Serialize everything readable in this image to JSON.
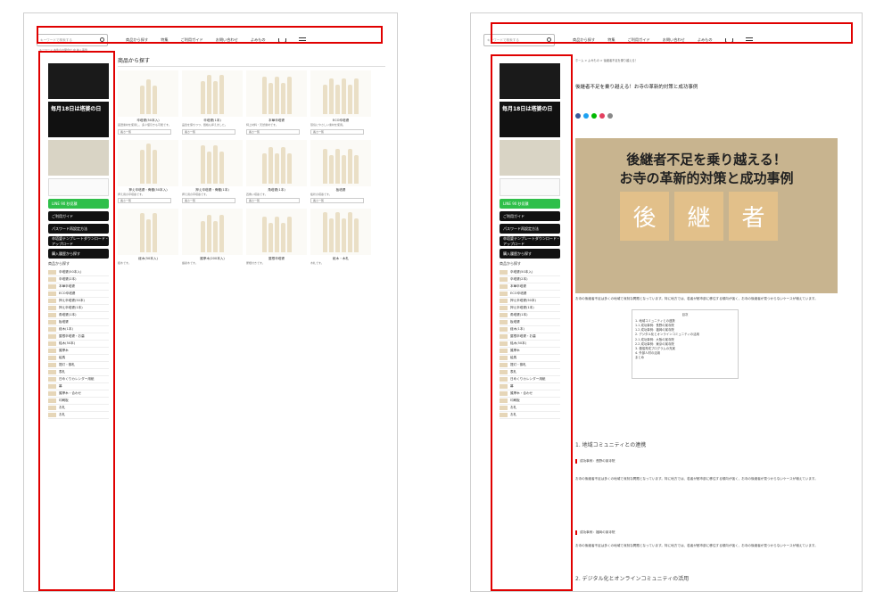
{
  "left": {
    "search_placeholder": "キーワードで検索する",
    "search_hint": "キーワード 本件のお問合せ 中 納入事例",
    "nav": [
      "商品から探す",
      "特集",
      "ご利用ガイド",
      "お問い合わせ",
      "よみもの"
    ],
    "sidebar_buttons": [
      "LINE 90 秒見積",
      "ご利用ガイド",
      "パスワード再設定方法",
      "卒塔婆テンプレートダウンロード・アップロード",
      "購入履歴から探す"
    ],
    "sidebar_section": "商品から探す",
    "sidebar_cats": [
      "卒塔婆(50本入)",
      "卒塔婆(2本)",
      "本華卒塔婆",
      "ECO卒塔婆",
      "押え卒塔婆(50本)",
      "押え卒塔婆(1本)",
      "角塔婆(1本)",
      "板塔婆",
      "経木(1本)",
      "屋根卒塔婆・お墓",
      "銘木(50本)",
      "護摩木",
      "絵馬",
      "提灯・御札",
      "表札",
      "日めくりカレンダー用紙",
      "幕",
      "護摩木・合わせ",
      "印刷板",
      "お札",
      "お札"
    ],
    "grid_title": "商品から探す",
    "products": [
      {
        "name": "卒塔婆(50本入)",
        "desc": "厳選素材を使用し、多少値引きも可能です。"
      },
      {
        "name": "卒塔婆(1本)",
        "desc": "品質を保ちつつ、価格も抑えました。"
      },
      {
        "name": "本華卒塔婆",
        "desc": "特上材料・天然素材です。"
      },
      {
        "name": "ECO卒塔婆",
        "desc": "環境にやさしい素材を使用。"
      },
      {
        "name": "押え卒塔婆・骨棚(50本入)",
        "desc": "押え用の卒塔婆です。"
      },
      {
        "name": "押え卒塔婆・骨棚(1本)",
        "desc": "押え用の卒塔婆です。"
      },
      {
        "name": "角塔婆(1本)",
        "desc": "四角い塔婆です。"
      },
      {
        "name": "板塔婆",
        "desc": "板状の塔婆です。"
      },
      {
        "name": "経木(50本入)",
        "desc": "経木です。"
      },
      {
        "name": "護摩木(200本入)",
        "desc": "護摩木です。"
      },
      {
        "name": "屋根卒塔婆",
        "desc": "屋根付きです。"
      },
      {
        "name": "紙木・木札",
        "desc": "木札です。"
      }
    ],
    "select_label": "長さ一覧",
    "feature_title": "特集"
  },
  "right": {
    "search_placeholder": "キーワードで検索する",
    "nav": [
      "商品から探す",
      "特集",
      "ご利用ガイド",
      "お問い合わせ",
      "よみもの"
    ],
    "breadcrumb": "ホーム > よみもの > 後継者不足を乗り越える！",
    "article_title": "後継者不足を乗り越える！お寺の革新的対策と成功事例",
    "photo_caption_1": "後継者不足を乗り越える！",
    "photo_caption_2": "お寺の革新的対策と成功事例",
    "blocks": [
      "後",
      "継",
      "者"
    ],
    "toc_title": "目次",
    "toc": [
      "1. 地域コミュニティとの連携",
      "1.1 成功事例：長野の某寺院",
      "1.2 成功事例：福岡の某寺院",
      "2. デジタル化とオンラインコミュニティの活用",
      "2.1 成功事例：大阪の某寺院",
      "2.2 成功事例：東京の某寺院",
      "3. 僧侶育成プログラムの充実",
      "4. 外部人材の活用",
      "まとめ"
    ],
    "h1": "1. 地域コミュニティとの連携",
    "sub1": "成功事例：長野の某寺院",
    "sub2": "成功事例：福岡の某寺院",
    "h2": "2. デジタル化とオンラインコミュニティの活用",
    "para": "お寺の後継者不足は多くの地域で深刻な問題となっています。特に地方では、若者が都市部に移住する傾向が強く、お寺の後継者が見つからないケースが増えています。"
  },
  "colors": {
    "highlight": "#e00000",
    "green": "#2fbf4a"
  }
}
